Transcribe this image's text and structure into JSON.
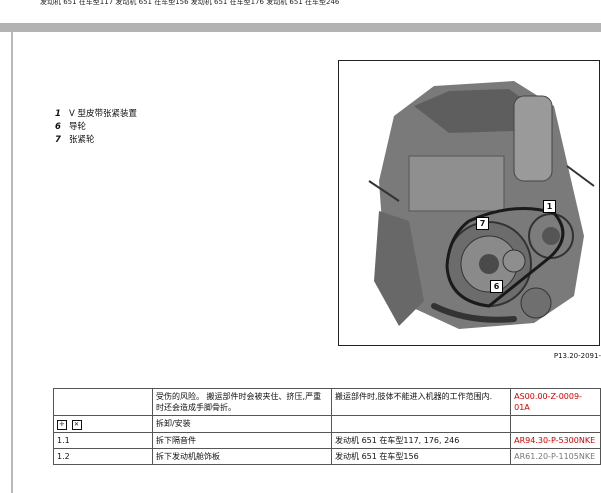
{
  "header": {
    "running_text": "发动机 651 在车型117 发动机 651 在车型156 发动机 651 在车型176 发动机 651 在车型246"
  },
  "legend": [
    {
      "num": "1",
      "label": "V 型皮带张紧装置"
    },
    {
      "num": "6",
      "label": "导轮"
    },
    {
      "num": "7",
      "label": "张紧轮"
    }
  ],
  "figure": {
    "code": "P13.20-2091-"
  },
  "callouts": [
    "1",
    "7",
    "6"
  ],
  "table": {
    "rows": [
      {
        "col1": "",
        "col2": "受伤的风险。 搬运部件时会被夹住、挤压,严重时还会造成手脚骨折。",
        "col3": "搬运部件时,肢体不能进入机器的工作范围内.",
        "col4": "AS00.00-Z-0009-01A"
      },
      {
        "col1": "",
        "col2": "拆卸/安装",
        "col3": "",
        "col4": ""
      },
      {
        "col1": "1.1",
        "col2": "拆下隔音件",
        "col3": "发动机 651 在车型117, 176, 246",
        "col4": "AR94.30-P-5300NKE"
      },
      {
        "col1": "1.2",
        "col2": "拆下发动机舱饰板",
        "col3": "发动机 651 在车型156",
        "col4": "AR61.20-P-1105NKE"
      }
    ]
  },
  "colors": {
    "red_code": "#d40000",
    "rule_gray": "#b3b3b3"
  }
}
